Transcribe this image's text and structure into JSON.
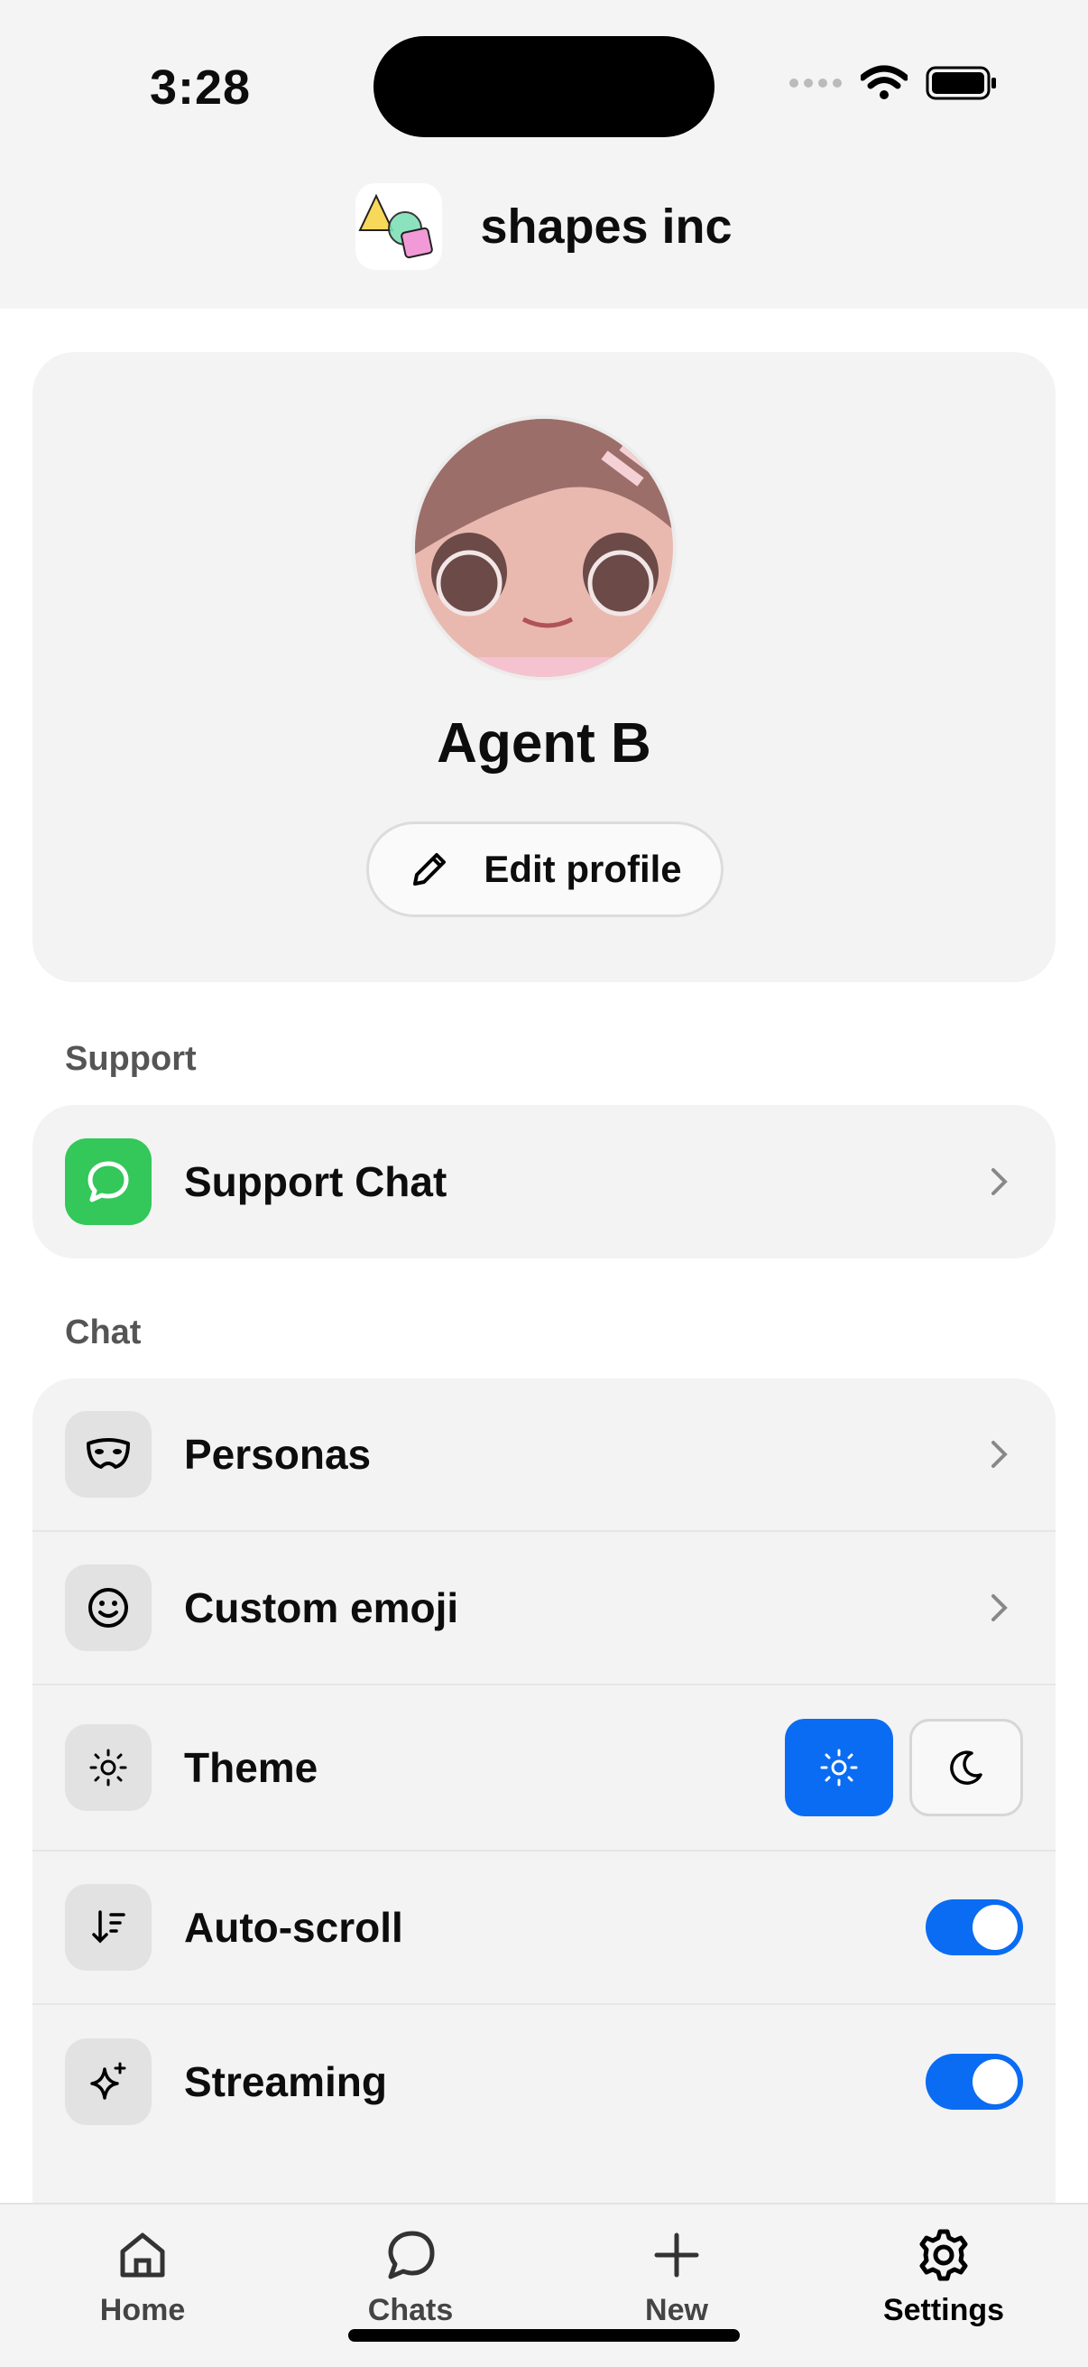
{
  "status": {
    "time": "3:28"
  },
  "header": {
    "brand": "shapes inc"
  },
  "profile": {
    "name": "Agent B",
    "edit_label": "Edit profile"
  },
  "support": {
    "section_label": "Support",
    "items": [
      {
        "label": "Support Chat",
        "icon": "chat-bubble-icon"
      }
    ]
  },
  "chat": {
    "section_label": "Chat",
    "items": [
      {
        "label": "Personas",
        "icon": "mask-icon"
      },
      {
        "label": "Custom emoji",
        "icon": "smiley-icon"
      },
      {
        "label": "Theme",
        "icon": "sun-icon",
        "value": "light"
      },
      {
        "label": "Auto-scroll",
        "icon": "sort-down-icon",
        "enabled": true
      },
      {
        "label": "Streaming",
        "icon": "sparkle-icon",
        "enabled": true
      }
    ]
  },
  "tabs": [
    {
      "label": "Home",
      "icon": "home-icon"
    },
    {
      "label": "Chats",
      "icon": "chat-icon"
    },
    {
      "label": "New",
      "icon": "plus-icon"
    },
    {
      "label": "Settings",
      "icon": "gear-icon",
      "active": true
    }
  ],
  "colors": {
    "accent": "#0a6cf2",
    "support_green": "#34c759",
    "card_bg": "#f3f3f3"
  }
}
